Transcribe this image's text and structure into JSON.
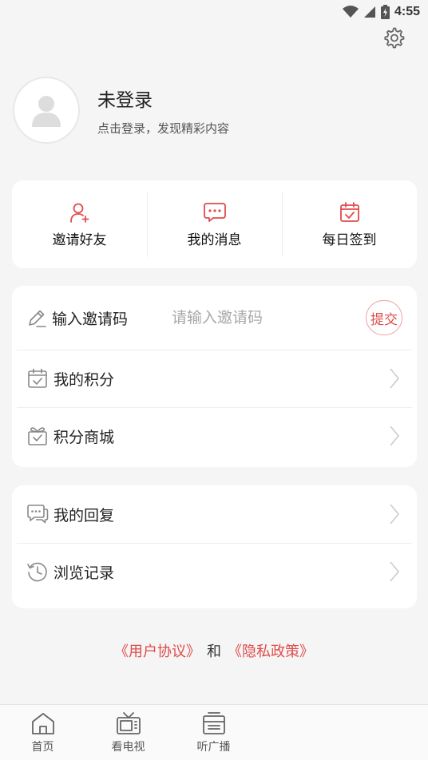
{
  "status_bar": {
    "time": "4:55"
  },
  "icons": {
    "settings": "gear-icon",
    "avatar": "user-silhouette-icon",
    "invite_friends": "add-user-icon",
    "messages": "chat-bubble-icon",
    "daily_checkin": "calendar-check-icon",
    "invite_code": "pencil-icon",
    "points": "calendar-check-icon",
    "points_mall": "gift-box-icon",
    "replies": "comments-icon",
    "history": "clock-history-icon",
    "chevron": "chevron-right-icon"
  },
  "profile": {
    "name": "未登录",
    "subtitle": "点击登录，发现精彩内容"
  },
  "quick_actions": [
    {
      "label": "邀请好友"
    },
    {
      "label": "我的消息"
    },
    {
      "label": "每日签到"
    }
  ],
  "invite": {
    "label": "输入邀请码",
    "placeholder": "请输入邀请码",
    "value": "",
    "submit_label": "提交"
  },
  "menu_group_1": [
    {
      "label": "我的积分"
    },
    {
      "label": "积分商城"
    }
  ],
  "menu_group_2": [
    {
      "label": "我的回复"
    },
    {
      "label": "浏览记录"
    }
  ],
  "agreements": {
    "user_agreement": "《用户协议》",
    "and": "和",
    "privacy_policy": "《隐私政策》"
  },
  "tabbar": [
    {
      "label": "首页",
      "icon": "home-icon"
    },
    {
      "label": "看电视",
      "icon": "tv-icon"
    },
    {
      "label": "听广播",
      "icon": "radio-icon"
    }
  ],
  "colors": {
    "accent": "#e14b4b",
    "background": "#f5f5f5",
    "card": "#ffffff"
  }
}
